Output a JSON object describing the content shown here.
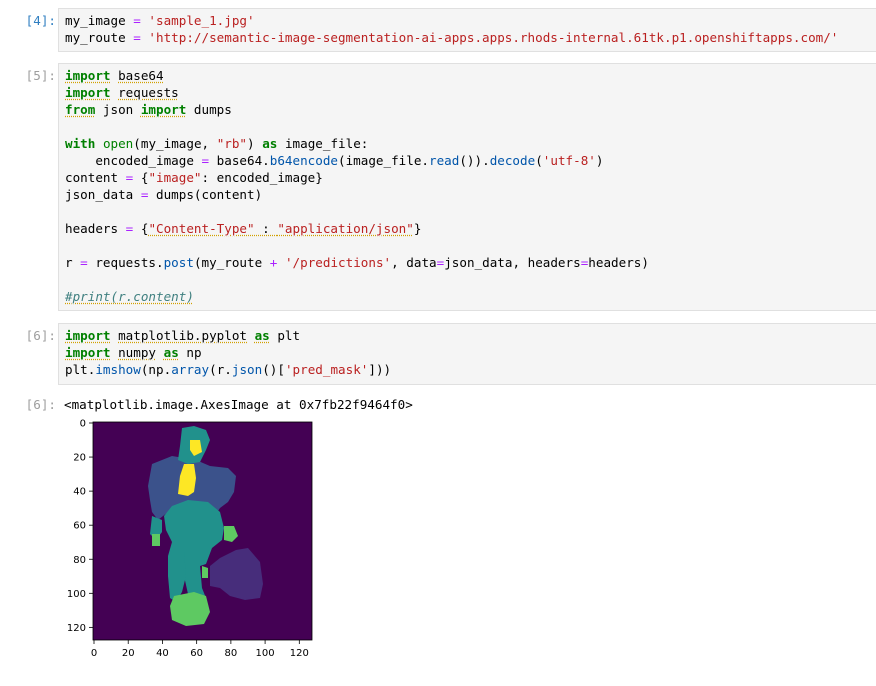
{
  "cells": [
    {
      "prompt": "[4]:",
      "active": true,
      "lines": [
        [
          [
            "my_image ",
            ""
          ],
          [
            "= ",
            "op"
          ],
          [
            "'sample_1.jpg'",
            "str"
          ]
        ],
        [
          [
            "my_route ",
            ""
          ],
          [
            "= ",
            "op"
          ],
          [
            "'http://semantic-image-segmentation-ai-apps.apps.rhods-internal.61tk.p1.openshiftapps.com/'",
            "str"
          ]
        ]
      ]
    },
    {
      "prompt": "[5]:",
      "active": false,
      "lines": [
        [
          [
            "import",
            "kw ul"
          ],
          [
            " ",
            ""
          ],
          [
            "base64",
            "ul"
          ]
        ],
        [
          [
            "import",
            "kw ul"
          ],
          [
            " ",
            ""
          ],
          [
            "requests",
            "ul"
          ]
        ],
        [
          [
            "from",
            "kw ul"
          ],
          [
            " json ",
            ""
          ],
          [
            "import",
            "kw ul"
          ],
          [
            " dumps",
            ""
          ]
        ],
        [
          [
            "",
            ""
          ]
        ],
        [
          [
            "with",
            "kw"
          ],
          [
            " ",
            ""
          ],
          [
            "open",
            "bi"
          ],
          [
            "(my_image, ",
            ""
          ],
          [
            "\"rb\"",
            "str"
          ],
          [
            ") ",
            ""
          ],
          [
            "as",
            "kw"
          ],
          [
            " image_file:",
            ""
          ]
        ],
        [
          [
            "    encoded_image ",
            ""
          ],
          [
            "=",
            "op"
          ],
          [
            " base64.",
            ""
          ],
          [
            "b64encode",
            "fn"
          ],
          [
            "(image_file.",
            ""
          ],
          [
            "read",
            "fn"
          ],
          [
            "()).",
            ""
          ],
          [
            "decode",
            "fn"
          ],
          [
            "(",
            ""
          ],
          [
            "'utf-8'",
            "str"
          ],
          [
            ")",
            ""
          ]
        ],
        [
          [
            "content ",
            ""
          ],
          [
            "=",
            "op"
          ],
          [
            " {",
            ""
          ],
          [
            "\"image\"",
            "str"
          ],
          [
            ": encoded_image}",
            ""
          ]
        ],
        [
          [
            "json_data ",
            ""
          ],
          [
            "=",
            "op"
          ],
          [
            " dumps(content)",
            ""
          ]
        ],
        [
          [
            "",
            ""
          ]
        ],
        [
          [
            "headers ",
            ""
          ],
          [
            "=",
            "op"
          ],
          [
            " {",
            ""
          ],
          [
            "\"Content-Type\"",
            "str ul"
          ],
          [
            " : ",
            "ul"
          ],
          [
            "\"application/json\"",
            "str ul"
          ],
          [
            "}",
            ""
          ]
        ],
        [
          [
            "",
            ""
          ]
        ],
        [
          [
            "r ",
            ""
          ],
          [
            "=",
            "op"
          ],
          [
            " requests.",
            ""
          ],
          [
            "post",
            "fn"
          ],
          [
            "(my_route ",
            ""
          ],
          [
            "+",
            "op"
          ],
          [
            " ",
            ""
          ],
          [
            "'/predictions'",
            "str"
          ],
          [
            ", data",
            ""
          ],
          [
            "=",
            "op"
          ],
          [
            "json_data, headers",
            ""
          ],
          [
            "=",
            "op"
          ],
          [
            "headers)",
            ""
          ]
        ],
        [
          [
            "",
            ""
          ]
        ],
        [
          [
            "#print(r.content)",
            "cm ul"
          ]
        ]
      ]
    },
    {
      "prompt": "[6]:",
      "active": false,
      "lines": [
        [
          [
            "import",
            "kw ul"
          ],
          [
            " ",
            ""
          ],
          [
            "matplotlib.pyplot",
            "ul"
          ],
          [
            " ",
            ""
          ],
          [
            "as",
            "kw ul"
          ],
          [
            " plt",
            ""
          ]
        ],
        [
          [
            "import",
            "kw ul"
          ],
          [
            " ",
            ""
          ],
          [
            "numpy",
            "ul"
          ],
          [
            " ",
            ""
          ],
          [
            "as",
            "kw ul"
          ],
          [
            " np",
            ""
          ]
        ],
        [
          [
            "plt.",
            ""
          ],
          [
            "imshow",
            "fn"
          ],
          [
            "(np.",
            ""
          ],
          [
            "array",
            "fn"
          ],
          [
            "(r.",
            ""
          ],
          [
            "json",
            "fn"
          ],
          [
            "()[",
            ""
          ],
          [
            "'pred_mask'",
            "str"
          ],
          [
            "]))",
            ""
          ]
        ]
      ]
    }
  ],
  "output": {
    "prompt": "[6]:",
    "text": "<matplotlib.image.AxesImage at 0x7fb22f9464f0>"
  },
  "plot": {
    "y_ticks": [
      "0",
      "20",
      "40",
      "60",
      "80",
      "100",
      "120"
    ],
    "x_ticks": [
      "0",
      "20",
      "40",
      "60",
      "80",
      "100",
      "120"
    ],
    "colors": {
      "background": "#440154",
      "dark_blue": "#3b528b",
      "teal": "#21918c",
      "green": "#5ec962",
      "yellow": "#fde725",
      "purple": "#472d7b",
      "navy": "#31688e"
    }
  }
}
